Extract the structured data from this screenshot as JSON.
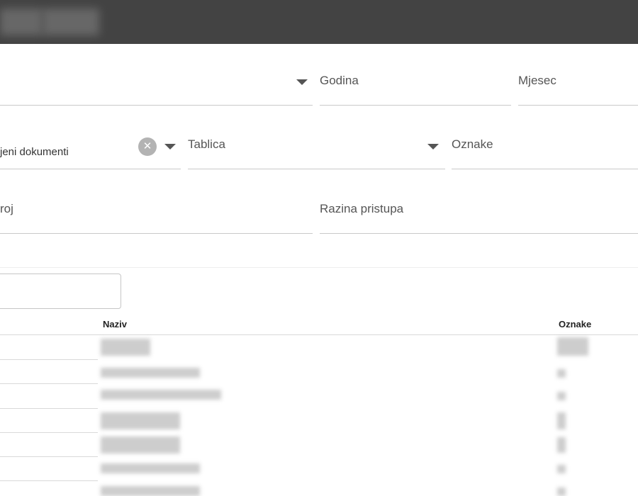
{
  "header": {
    "title": ""
  },
  "filters": {
    "row1": {
      "first_label": "",
      "godina_label": "Godina",
      "mjesec_label": "Mjesec"
    },
    "row2": {
      "dokumenti_value": "jeni dokumenti",
      "tablica_label": "Tablica",
      "oznake_label": "Oznake"
    },
    "row3": {
      "broj_label": "roj",
      "razina_label": "Razina pristupa"
    }
  },
  "search": {
    "value": ""
  },
  "table": {
    "columns": [
      "",
      "Naziv",
      "Oznake"
    ],
    "row_count": 7
  },
  "icons": {
    "dropdown": "caret-down-icon",
    "clear": "clear-icon"
  }
}
